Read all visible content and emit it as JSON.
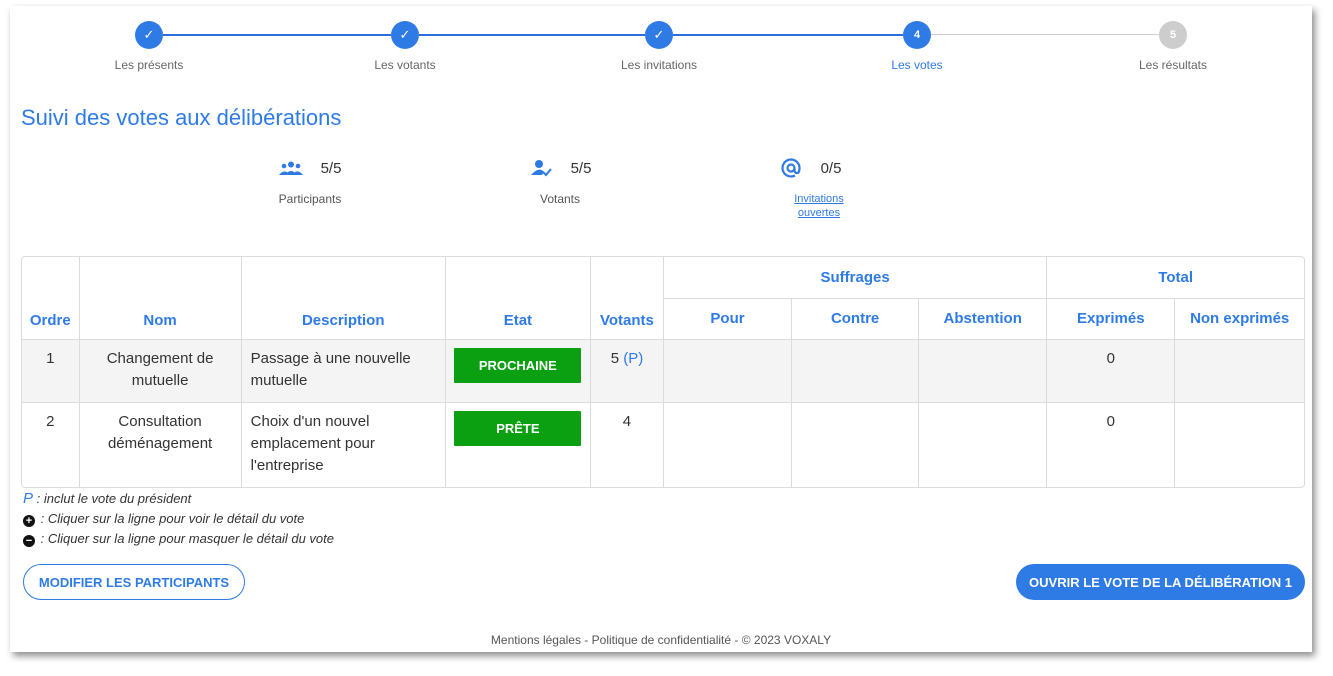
{
  "stepper": {
    "steps": [
      {
        "label": "Les présents",
        "state": "done",
        "number": "1"
      },
      {
        "label": "Les votants",
        "state": "done",
        "number": "2"
      },
      {
        "label": "Les invitations",
        "state": "done",
        "number": "3"
      },
      {
        "label": "Les votes",
        "state": "active",
        "number": "4"
      },
      {
        "label": "Les résultats",
        "state": "disabled",
        "number": "5"
      }
    ],
    "check_glyph": "✓"
  },
  "page_title": "Suivi des votes aux délibérations",
  "stats": {
    "participants": {
      "value": "5/5",
      "label": "Participants",
      "icon": "group-icon"
    },
    "votants": {
      "value": "5/5",
      "label": "Votants",
      "icon": "person-check-icon"
    },
    "invitations": {
      "value": "0/5",
      "label": "Invitations ouvertes",
      "icon": "at-icon"
    }
  },
  "table": {
    "group_headers": {
      "suffrages": "Suffrages",
      "total": "Total"
    },
    "headers": {
      "ordre": "Ordre",
      "nom": "Nom",
      "description": "Description",
      "etat": "Etat",
      "votants": "Votants",
      "pour": "Pour",
      "contre": "Contre",
      "abstention": "Abstention",
      "exprimes": "Exprimés",
      "non_exprimes": "Non exprimés"
    },
    "rows": [
      {
        "ordre": "1",
        "nom": "Changement de mutuelle",
        "description": "Passage à une nouvelle mutuelle",
        "etat": "PROCHAINE",
        "votants": "5",
        "votants_flag": "(P)",
        "pour": "",
        "contre": "",
        "abstention": "",
        "exprimes": "0",
        "non_exprimes": ""
      },
      {
        "ordre": "2",
        "nom": "Consultation déménagement",
        "description": "Choix d'un nouvel emplacement pour l'entreprise",
        "etat": "PRÊTE",
        "votants": "4",
        "votants_flag": "",
        "pour": "",
        "contre": "",
        "abstention": "",
        "exprimes": "0",
        "non_exprimes": ""
      }
    ]
  },
  "legend": {
    "p_mark": "P",
    "p_text": " : inclut le vote du président",
    "plus_glyph": "+",
    "plus_text": " : Cliquer sur la ligne pour voir le détail du vote",
    "minus_glyph": "−",
    "minus_text": " : Cliquer sur la ligne pour masquer le détail du vote"
  },
  "buttons": {
    "modify": "MODIFIER LES PARTICIPANTS",
    "open_vote": "OUVRIR LE VOTE DE LA DÉLIBÉRATION 1"
  },
  "footer": "Mentions légales - Politique de confidentialité - © 2023 VOXALY",
  "colors": {
    "accent": "#2f7be5",
    "status_green": "#0aa012",
    "disabled": "#cdcdcd"
  }
}
